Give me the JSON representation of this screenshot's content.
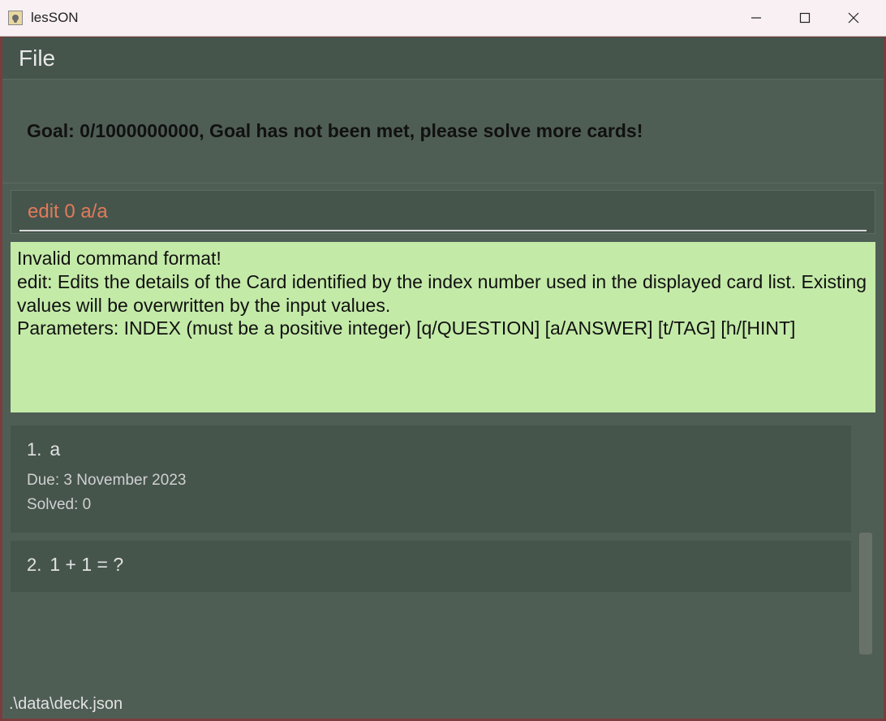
{
  "window": {
    "title": "lesSON"
  },
  "menubar": {
    "file": "File"
  },
  "goal": {
    "text": "Goal: 0/1000000000, Goal has not been met, please solve more cards!"
  },
  "command": {
    "value": "edit 0 a/a"
  },
  "feedback": {
    "text": "Invalid command format! \nedit: Edits the details of the Card identified by the index number used in the displayed card list. Existing values will be overwritten by the input values.\nParameters: INDEX (must be a positive integer) [q/QUESTION] [a/ANSWER] [t/TAG] [h/[HINT]"
  },
  "cards": [
    {
      "index": "1.",
      "question": "a",
      "due_label": "Due: 3 November 2023",
      "solved_label": "Solved: 0"
    },
    {
      "index": "2.",
      "question": "1 + 1 = ?",
      "due_label": "",
      "solved_label": ""
    }
  ],
  "status": {
    "path": ".\\data\\deck.json"
  }
}
